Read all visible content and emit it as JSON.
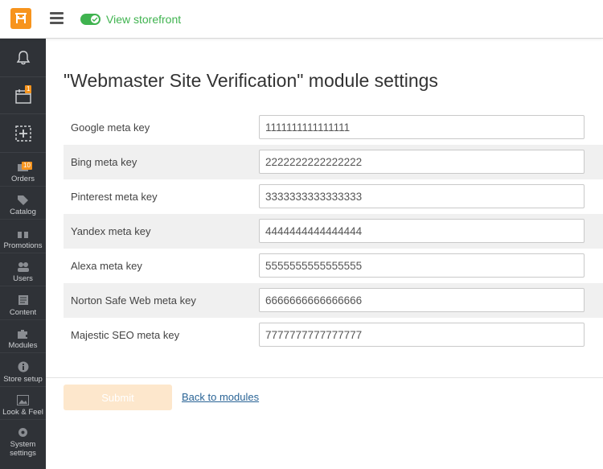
{
  "topbar": {
    "logo_icon": "store-logo-icon",
    "menu_icon": "hamburger-menu-icon",
    "storefront_label": "View storefront",
    "storefront_enabled": true,
    "accent_color": "#3fb34f",
    "brand_color": "#f7941d"
  },
  "sidebar": {
    "items": [
      {
        "label": "",
        "icon": "bell-icon"
      },
      {
        "label": "",
        "icon": "calendar-icon",
        "badge": "1"
      },
      {
        "label": "",
        "icon": "add-icon"
      },
      {
        "label": "Orders",
        "icon": "orders-icon",
        "badge": "10"
      },
      {
        "label": "Catalog",
        "icon": "tag-icon"
      },
      {
        "label": "Promotions",
        "icon": "gift-icon"
      },
      {
        "label": "Users",
        "icon": "users-icon"
      },
      {
        "label": "Content",
        "icon": "content-icon"
      },
      {
        "label": "Modules",
        "icon": "puzzle-icon"
      },
      {
        "label": "Store setup",
        "icon": "info-icon"
      },
      {
        "label": "Look & Feel",
        "icon": "image-icon"
      },
      {
        "label": "System settings",
        "icon": "gear-icon"
      }
    ]
  },
  "page": {
    "title": "\"Webmaster Site Verification\" module settings"
  },
  "form": {
    "fields": [
      {
        "label": "Google meta key",
        "value": "1111111111111111"
      },
      {
        "label": "Bing meta key",
        "value": "2222222222222222"
      },
      {
        "label": "Pinterest meta key",
        "value": "3333333333333333"
      },
      {
        "label": "Yandex meta key",
        "value": "4444444444444444"
      },
      {
        "label": "Alexa meta key",
        "value": "5555555555555555"
      },
      {
        "label": "Norton Safe Web meta key",
        "value": "6666666666666666"
      },
      {
        "label": "Majestic SEO meta key",
        "value": "7777777777777777"
      }
    ],
    "submit_label": "Submit",
    "back_label": "Back to modules"
  }
}
